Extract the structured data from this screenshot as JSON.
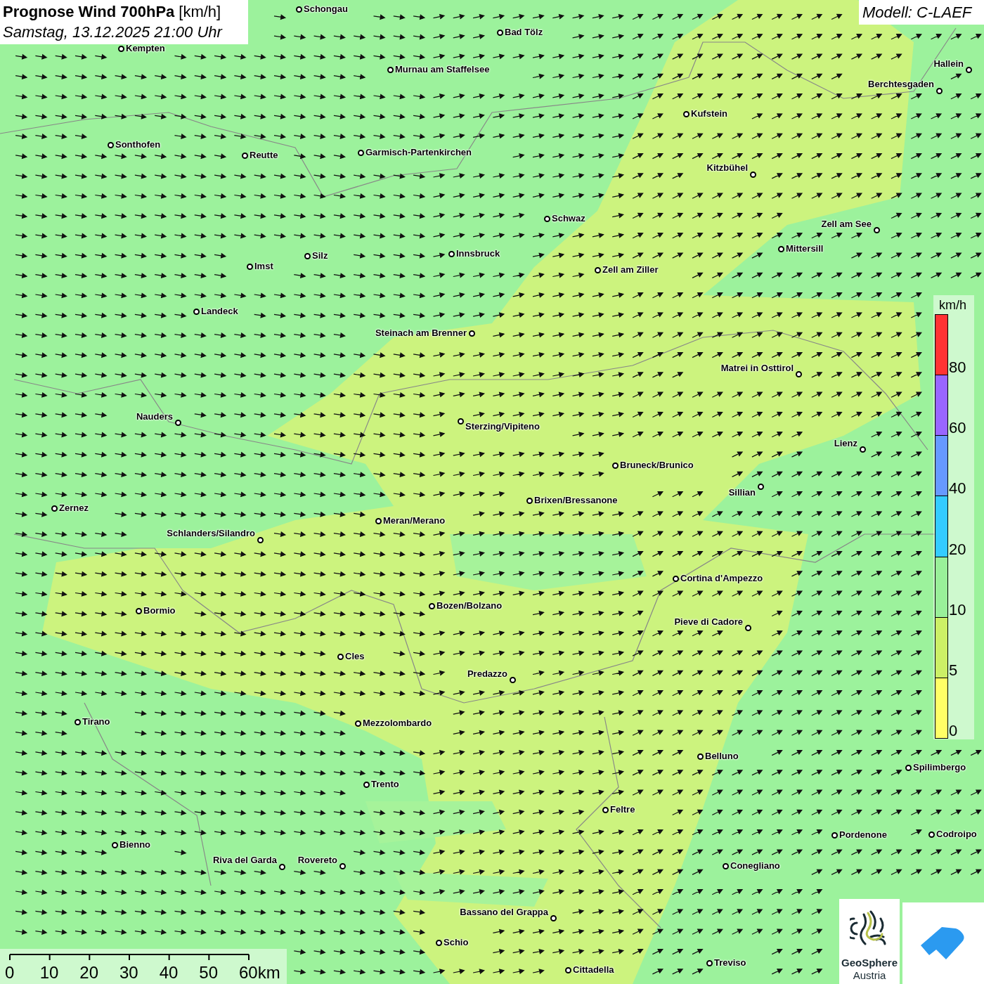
{
  "title": {
    "main": "Prognose Wind 700hPa",
    "unit": "[km/h]",
    "time": "Samstag, 13.12.2025 21:00 Uhr"
  },
  "model": "Modell: C-LAEF",
  "cities": [
    {
      "name": "Schongau"
    },
    {
      "name": "Bad Tölz"
    },
    {
      "name": "Kempten"
    },
    {
      "name": "Murnau am Staffelsee"
    },
    {
      "name": "Hallein"
    },
    {
      "name": "Berchtesgaden"
    },
    {
      "name": "Kufstein"
    },
    {
      "name": "Sonthofen"
    },
    {
      "name": "Reutte"
    },
    {
      "name": "Garmisch-Partenkirchen"
    },
    {
      "name": "Kitzbühel"
    },
    {
      "name": "Schwaz"
    },
    {
      "name": "Zell am See"
    },
    {
      "name": "Mittersill"
    },
    {
      "name": "Innsbruck"
    },
    {
      "name": "Silz"
    },
    {
      "name": "Imst"
    },
    {
      "name": "Zell am Ziller"
    },
    {
      "name": "Landeck"
    },
    {
      "name": "Steinach am Brenner"
    },
    {
      "name": "Matrei in Osttirol"
    },
    {
      "name": "Nauders"
    },
    {
      "name": "Sterzing/Vipiteno"
    },
    {
      "name": "Lienz"
    },
    {
      "name": "Bruneck/Brunico"
    },
    {
      "name": "Sillian"
    },
    {
      "name": "Brixen/Bressanone"
    },
    {
      "name": "Zernez"
    },
    {
      "name": "Meran/Merano"
    },
    {
      "name": "Schlanders/Silandro"
    },
    {
      "name": "Cortina d'Ampezzo"
    },
    {
      "name": "Bozen/Bolzano"
    },
    {
      "name": "Bormio"
    },
    {
      "name": "Pieve di Cadore"
    },
    {
      "name": "Cles"
    },
    {
      "name": "Predazzo"
    },
    {
      "name": "Tirano"
    },
    {
      "name": "Mezzolombardo"
    },
    {
      "name": "Belluno"
    },
    {
      "name": "Spilimbergo"
    },
    {
      "name": "Trento"
    },
    {
      "name": "Feltre"
    },
    {
      "name": "Pordenone"
    },
    {
      "name": "Codroipo"
    },
    {
      "name": "Bienno"
    },
    {
      "name": "Riva del Garda"
    },
    {
      "name": "Rovereto"
    },
    {
      "name": "Conegliano"
    },
    {
      "name": "Bassano del Grappa"
    },
    {
      "name": "Schio"
    },
    {
      "name": "Treviso"
    },
    {
      "name": "Cittadella"
    }
  ],
  "legend": {
    "unit": "km/h",
    "steps": [
      {
        "label": "80",
        "color": "#ff3333"
      },
      {
        "label": "60",
        "color": "#9966ff"
      },
      {
        "label": "40",
        "color": "#6699ff"
      },
      {
        "label": "20",
        "color": "#33ccff"
      },
      {
        "label": "10",
        "color": "#99f099"
      },
      {
        "label": "5",
        "color": "#ccf066"
      },
      {
        "label": "0",
        "color": "#ffff66"
      }
    ]
  },
  "scale": {
    "ticks": [
      "0",
      "10",
      "20",
      "30",
      "40",
      "50",
      "60km"
    ]
  },
  "logos": {
    "geosphere": [
      "GeoSphere",
      "Austria"
    ]
  }
}
